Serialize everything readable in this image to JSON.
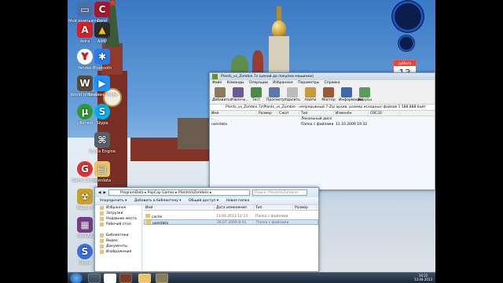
{
  "desktop_icons": [
    {
      "label": "Мой компьютер",
      "color": "#4b6fa8",
      "glyph": "▭"
    },
    {
      "label": "Corel",
      "color": "#a8162e",
      "glyph": "C"
    },
    {
      "label": "Avira",
      "color": "#d71f27",
      "glyph": "A"
    },
    {
      "label": "AIMP",
      "color": "#2b2b2b",
      "glyph": "▲"
    },
    {
      "label": "Yandex",
      "color": "#ffffff",
      "glyph": "Y"
    },
    {
      "label": "Bluetooth",
      "color": "#2c7be5",
      "glyph": "✱"
    },
    {
      "label": "World of Tanks",
      "color": "#5a4a3a",
      "glyph": "W"
    },
    {
      "label": "Windows Media",
      "color": "#1e90ff",
      "glyph": "▶"
    },
    {
      "label": "uTorrent",
      "color": "#2e9b2e",
      "glyph": "µ"
    },
    {
      "label": "Skype",
      "color": "#00aff0",
      "glyph": "S"
    },
    {
      "label": "Crysis Engine",
      "color": "#55606b",
      "glyph": "⌘"
    },
    {
      "label": "Game Center",
      "color": "#d33",
      "glyph": "G"
    },
    {
      "label": "userdata",
      "color": "#e9c46a",
      "glyph": "▤"
    },
    {
      "label": "Fallout 3",
      "color": "#c9a227",
      "glyph": "☢"
    },
    {
      "label": "WinRAR",
      "color": "#7a3b8f",
      "glyph": "▦"
    },
    {
      "label": "Skype",
      "color": "#3a6fd8",
      "glyph": "S"
    }
  ],
  "gadgets": {
    "calendar_month": "суббота",
    "calendar_day": "13"
  },
  "rar_window": {
    "title": "Plants_vs_Zombie.7z (ценой до покупки машинки)",
    "menu": [
      "Файл",
      "Команды",
      "Операции",
      "Избранное",
      "Параметры",
      "Справка"
    ],
    "toolbar": [
      "Добавить",
      "Извлечь...",
      "Тест",
      "Просмотр",
      "Удалить",
      "Найти",
      "Мастер",
      "Информация",
      "Вирусы"
    ],
    "path": "Plants_vs_Zombie.7z\\Plants_vs_Zombie - непрерывный 7-Zip архив, размер исходных файлов 1 588 888 байт",
    "columns": [
      "Имя",
      "Размер",
      "Сжат",
      "Тип",
      "Изменён",
      "CRC32"
    ],
    "rows": [
      {
        "name": "..",
        "size": "",
        "packed": "",
        "type": "Локальный диск",
        "modified": "",
        "crc": ""
      },
      {
        "name": "userdata",
        "size": "",
        "packed": "",
        "type": "Папка с файлами",
        "modified": "11.10.2009 19:32",
        "crc": ""
      }
    ]
  },
  "explorer_window": {
    "address": "ProgramData ▸ PopCap Games ▸ PlantsVsZombies ▸",
    "search_placeholder": "Поиск: PlantsVsZombies",
    "commands": [
      "Упорядочить ▾",
      "Добавить в библиотеку ▾",
      "Общий доступ ▾",
      "Новая папка"
    ],
    "nav": [
      "Избранное",
      "Загрузки",
      "Недавние места",
      "Рабочий стол",
      "",
      "Библиотеки",
      "Видео",
      "Документы",
      "Изображения"
    ],
    "columns": [
      "Имя",
      "Дата изменения",
      "Тип",
      "Размер"
    ],
    "rows": [
      {
        "name": "cache",
        "modified": "13.04.2013 12:13",
        "type": "Папка с файлами"
      },
      {
        "name": "userdata",
        "modified": "26.07.2009 8:41",
        "type": "Папка с файлами"
      }
    ]
  },
  "taskbar": {
    "time": "16:22",
    "date": "13.04.2013"
  }
}
